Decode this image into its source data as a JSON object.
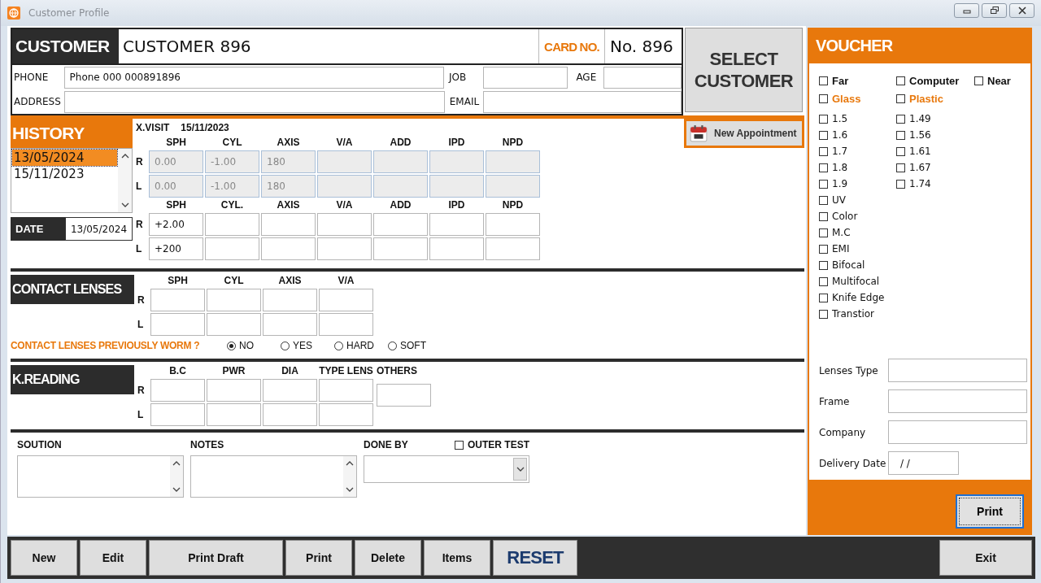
{
  "window": {
    "title": "Customer Profile"
  },
  "customer": {
    "label": "CUSTOMER",
    "name": "CUSTOMER 896",
    "card_label": "CARD NO.",
    "card_no": "No. 896",
    "select_button": "SELECT CUSTOMER",
    "phone": {
      "label": "PHONE",
      "value": "Phone 000 000891896"
    },
    "job": {
      "label": "JOB"
    },
    "age": {
      "label": "AGE"
    },
    "address": {
      "label": "ADDRESS"
    },
    "email": {
      "label": "EMAIL"
    }
  },
  "history": {
    "title": "HISTORY",
    "dates": [
      {
        "label": "13/05/2024",
        "selected": true
      },
      {
        "label": "15/11/2023",
        "selected": false
      }
    ],
    "date_label": "DATE",
    "date_value": "13/05/2024",
    "visit_label": "X.VISIT",
    "visit_date": "15/11/2023",
    "new_appointment": "New Appointment",
    "previous": {
      "columns": [
        "SPH",
        "CYL",
        "AXIS",
        "V/A",
        "ADD",
        "IPD",
        "NPD"
      ],
      "rows": [
        {
          "side": "R",
          "values": [
            "0.00",
            "-1.00",
            "180"
          ]
        },
        {
          "side": "L",
          "values": [
            "0.00",
            "-1.00",
            "180"
          ]
        }
      ]
    },
    "current": {
      "columns": [
        "SPH",
        "CYL.",
        "AXIS",
        "V/A",
        "ADD",
        "IPD",
        "NPD"
      ],
      "rows": [
        {
          "side": "R",
          "values": [
            "+2.00"
          ]
        },
        {
          "side": "L",
          "values": [
            "+200"
          ]
        }
      ]
    }
  },
  "contact_lenses": {
    "title": "CONTACT LENSES",
    "columns": [
      "SPH",
      "CYL",
      "AXIS",
      "V/A"
    ],
    "rows": [
      {
        "side": "R",
        "values": []
      },
      {
        "side": "L",
        "values": []
      }
    ],
    "question": "CONTACT LENSES PREVIOUSLY WORM ?",
    "options": [
      {
        "label": "NO",
        "selected": true
      },
      {
        "label": "YES",
        "selected": false
      },
      {
        "label": "HARD",
        "selected": false
      },
      {
        "label": "SOFT",
        "selected": false
      }
    ]
  },
  "k_reading": {
    "title": "K.READING",
    "columns": [
      "B.C",
      "PWR",
      "DIA",
      "TYPE LENS"
    ],
    "others_label": "OTHERS",
    "rows": [
      {
        "side": "R",
        "values": []
      },
      {
        "side": "L",
        "values": []
      }
    ]
  },
  "notes": {
    "solution_label": "SOUTION",
    "notes_label": "NOTES",
    "done_by_label": "DONE BY",
    "outer_test": {
      "label": "OUTER TEST",
      "checked": false
    }
  },
  "voucher": {
    "title": "VOUCHER",
    "vision": [
      {
        "label": "Far",
        "checked": false
      },
      {
        "label": "Computer",
        "checked": false
      },
      {
        "label": "Near",
        "checked": false
      }
    ],
    "material": [
      {
        "label": "Glass",
        "checked": false
      },
      {
        "label": "Plastic",
        "checked": false
      }
    ],
    "left_options": [
      {
        "label": "1.5",
        "checked": false
      },
      {
        "label": "1.6",
        "checked": false
      },
      {
        "label": "1.7",
        "checked": false
      },
      {
        "label": "1.8",
        "checked": false
      },
      {
        "label": "1.9",
        "checked": false
      },
      {
        "label": "UV",
        "checked": false
      },
      {
        "label": "Color",
        "checked": false
      },
      {
        "label": "M.C",
        "checked": false
      },
      {
        "label": "EMI",
        "checked": false
      },
      {
        "label": "Bifocal",
        "checked": false
      },
      {
        "label": "Multifocal",
        "checked": false
      },
      {
        "label": "Knife Edge",
        "checked": false
      },
      {
        "label": "Transtior",
        "checked": false
      }
    ],
    "right_options": [
      {
        "label": "1.49",
        "checked": false
      },
      {
        "label": "1.56",
        "checked": false
      },
      {
        "label": "1.61",
        "checked": false
      },
      {
        "label": "1.67",
        "checked": false
      },
      {
        "label": "1.74",
        "checked": false
      }
    ],
    "fields": [
      {
        "label": "Lenses Type",
        "kind": "wide"
      },
      {
        "label": "Frame",
        "kind": "wide"
      },
      {
        "label": "Company",
        "kind": "wide"
      },
      {
        "label": "Delivery Date",
        "kind": "date",
        "value": "/ /"
      }
    ],
    "print_button": "Print"
  },
  "buttons": [
    {
      "label": "New",
      "kind": "action"
    },
    {
      "label": "Edit",
      "kind": "action"
    },
    {
      "label": "Print Draft",
      "kind": "wide"
    },
    {
      "label": "Print",
      "kind": "action"
    },
    {
      "label": "Delete",
      "kind": "action"
    },
    {
      "label": "Items",
      "kind": "action"
    },
    {
      "label": "RESET",
      "kind": "reset"
    },
    {
      "label": "Exit",
      "kind": "exit"
    }
  ]
}
